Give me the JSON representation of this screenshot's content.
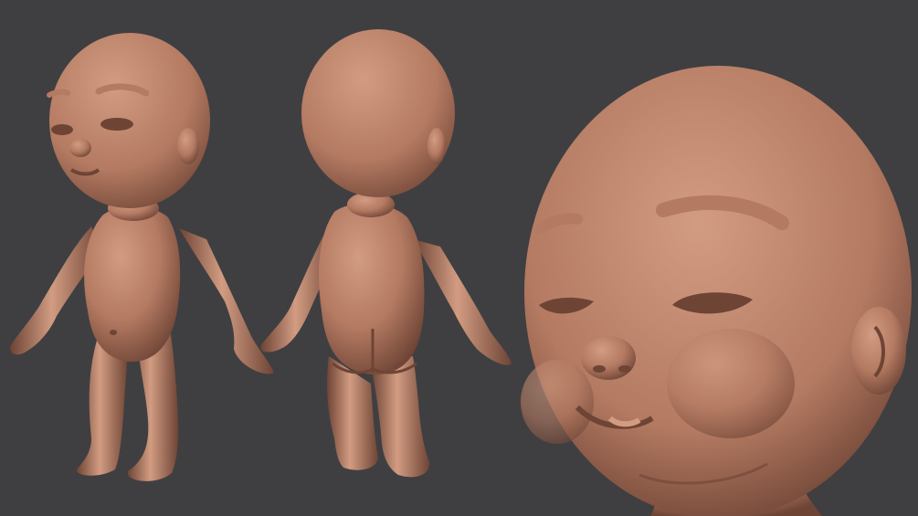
{
  "scene": {
    "background_color": "#3f3f41",
    "clay_color": "#b47a62",
    "clay_highlight": "#d29c82",
    "clay_shadow": "#6e4435",
    "views": [
      {
        "name": "front-view"
      },
      {
        "name": "back-view"
      },
      {
        "name": "face-closeup"
      }
    ]
  }
}
